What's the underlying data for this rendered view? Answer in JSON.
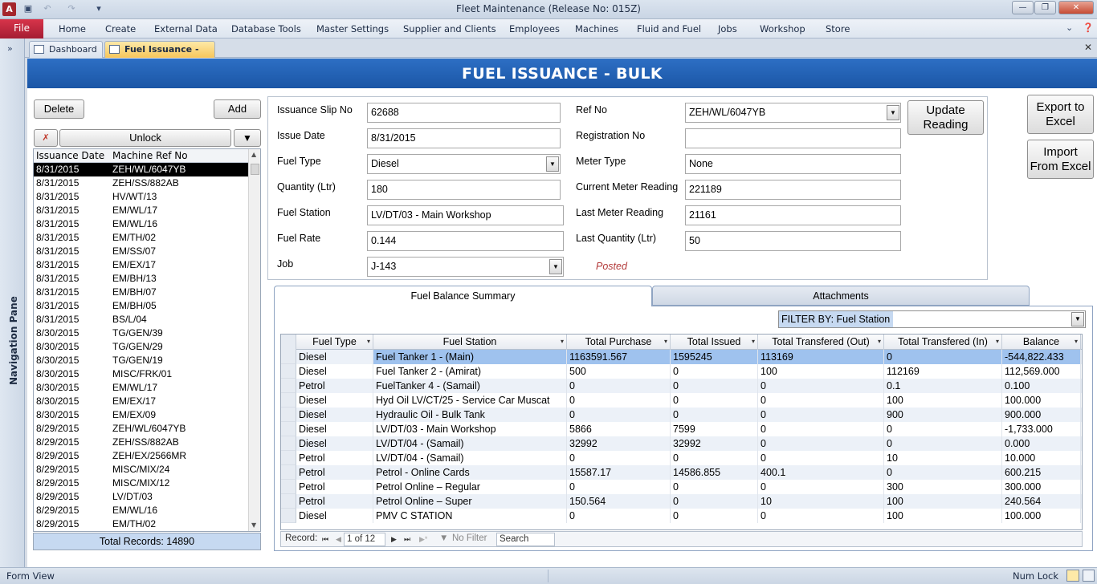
{
  "window": {
    "title": "Fleet Maintenance (Release No: 015Z)",
    "app_icon_letter": "A"
  },
  "ribbon": {
    "file": "File",
    "tabs": [
      "Home",
      "Create",
      "External Data",
      "Database Tools",
      "Master Settings",
      "Supplier and Clients",
      "Employees",
      "Machines",
      "Fluid and Fuel",
      "Jobs",
      "Workshop",
      "Store"
    ]
  },
  "nav_pane": {
    "label": "Navigation Pane",
    "toggle": "»"
  },
  "doc_tabs": [
    "Dashboard",
    "Fuel Issuance - Bulk"
  ],
  "header": {
    "title": "FUEL ISSUANCE - BULK"
  },
  "buttons": {
    "delete": "Delete",
    "add": "Add",
    "unlock": "Unlock",
    "update_reading": [
      "Update",
      "Reading"
    ],
    "export_excel": [
      "Export to",
      "Excel"
    ],
    "import_excel": [
      "Import",
      "From Excel"
    ]
  },
  "list": {
    "columns": [
      "Issuance Date",
      "Machine Ref No"
    ],
    "rows": [
      [
        "8/31/2015",
        "ZEH/WL/6047YB"
      ],
      [
        "8/31/2015",
        "ZEH/SS/882AB"
      ],
      [
        "8/31/2015",
        "HV/WT/13"
      ],
      [
        "8/31/2015",
        "EM/WL/17"
      ],
      [
        "8/31/2015",
        "EM/WL/16"
      ],
      [
        "8/31/2015",
        "EM/TH/02"
      ],
      [
        "8/31/2015",
        "EM/SS/07"
      ],
      [
        "8/31/2015",
        "EM/EX/17"
      ],
      [
        "8/31/2015",
        "EM/BH/13"
      ],
      [
        "8/31/2015",
        "EM/BH/07"
      ],
      [
        "8/31/2015",
        "EM/BH/05"
      ],
      [
        "8/31/2015",
        "BS/L/04"
      ],
      [
        "8/30/2015",
        "TG/GEN/39"
      ],
      [
        "8/30/2015",
        "TG/GEN/29"
      ],
      [
        "8/30/2015",
        "TG/GEN/19"
      ],
      [
        "8/30/2015",
        "MISC/FRK/01"
      ],
      [
        "8/30/2015",
        "EM/WL/17"
      ],
      [
        "8/30/2015",
        "EM/EX/17"
      ],
      [
        "8/30/2015",
        "EM/EX/09"
      ],
      [
        "8/29/2015",
        "ZEH/WL/6047YB"
      ],
      [
        "8/29/2015",
        "ZEH/SS/882AB"
      ],
      [
        "8/29/2015",
        "ZEH/EX/2566MR"
      ],
      [
        "8/29/2015",
        "MISC/MIX/24"
      ],
      [
        "8/29/2015",
        "MISC/MIX/12"
      ],
      [
        "8/29/2015",
        "LV/DT/03"
      ],
      [
        "8/29/2015",
        "EM/WL/16"
      ],
      [
        "8/29/2015",
        "EM/TH/02"
      ]
    ],
    "total_records": "Total Records: 14890"
  },
  "details": {
    "issuance_slip_no": {
      "label": "Issuance Slip No",
      "value": "62688"
    },
    "issue_date": {
      "label": "Issue Date",
      "value": "8/31/2015"
    },
    "fuel_type": {
      "label": "Fuel Type",
      "value": "Diesel"
    },
    "quantity": {
      "label": "Quantity (Ltr)",
      "value": "180"
    },
    "fuel_station": {
      "label": "Fuel Station",
      "value": "LV/DT/03 - Main Workshop"
    },
    "fuel_rate": {
      "label": "Fuel Rate",
      "value": "0.144"
    },
    "job": {
      "label": "Job",
      "value": "J-143"
    },
    "ref_no": {
      "label": "Ref No",
      "value": "ZEH/WL/6047YB"
    },
    "registration_no": {
      "label": "Registration No",
      "value": ""
    },
    "meter_type": {
      "label": "Meter Type",
      "value": "None"
    },
    "current_meter_reading": {
      "label": "Current Meter Reading",
      "value": "221189"
    },
    "last_meter_reading": {
      "label": "Last Meter Reading",
      "value": "21161"
    },
    "last_quantity": {
      "label": "Last Quantity (Ltr)",
      "value": "50"
    },
    "status": "Posted"
  },
  "tabs": {
    "summary": "Fuel Balance Summary",
    "attachments": "Attachments"
  },
  "filter": {
    "label": "FILTER BY: Fuel Station",
    "value": ""
  },
  "grid": {
    "columns": [
      "Fuel Type",
      "Fuel Station",
      "Total Purchase",
      "Total Issued",
      "Total Transfered (Out)",
      "Total Transfered (In)",
      "Balance"
    ],
    "rows": [
      [
        "Diesel",
        "Fuel Tanker 1 - (Main)",
        "1163591.567",
        "1595245",
        "113169",
        "0",
        "-544,822.433"
      ],
      [
        "Diesel",
        "Fuel Tanker 2 - (Amirat)",
        "500",
        "0",
        "100",
        "112169",
        "112,569.000"
      ],
      [
        "Petrol",
        "FuelTanker 4 - (Samail)",
        "0",
        "0",
        "0",
        "0.1",
        "0.100"
      ],
      [
        "Diesel",
        "Hyd Oil LV/CT/25 - Service Car Muscat",
        "0",
        "0",
        "0",
        "100",
        "100.000"
      ],
      [
        "Diesel",
        "Hydraulic Oil - Bulk Tank",
        "0",
        "0",
        "0",
        "900",
        "900.000"
      ],
      [
        "Diesel",
        "LV/DT/03 - Main Workshop",
        "5866",
        "7599",
        "0",
        "0",
        "-1,733.000"
      ],
      [
        "Diesel",
        "LV/DT/04 - (Samail)",
        "32992",
        "32992",
        "0",
        "0",
        "0.000"
      ],
      [
        "Petrol",
        "LV/DT/04 - (Samail)",
        "0",
        "0",
        "0",
        "10",
        "10.000"
      ],
      [
        "Petrol",
        "Petrol - Online Cards",
        "15587.17",
        "14586.855",
        "400.1",
        "0",
        "600.215"
      ],
      [
        "Petrol",
        "Petrol Online – Regular",
        "0",
        "0",
        "0",
        "300",
        "300.000"
      ],
      [
        "Petrol",
        "Petrol Online – Super",
        "150.564",
        "0",
        "10",
        "100",
        "240.564"
      ],
      [
        "Diesel",
        "PMV C STATION",
        "0",
        "0",
        "0",
        "100",
        "100.000"
      ]
    ]
  },
  "record_nav": {
    "label": "Record:",
    "position": "1 of 12",
    "no_filter": "No Filter",
    "search": "Search"
  },
  "status_bar": {
    "left": "Form View",
    "right": "Num Lock"
  }
}
